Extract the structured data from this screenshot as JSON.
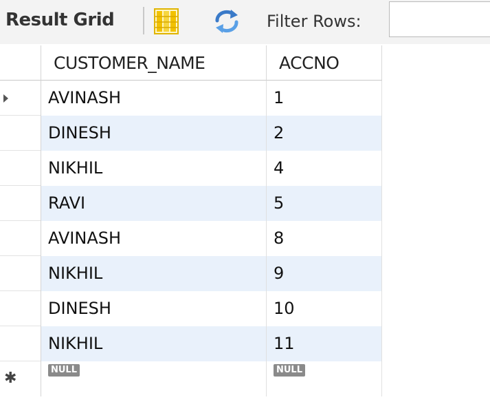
{
  "toolbar": {
    "title": "Result Grid",
    "filter_label": "Filter Rows:",
    "filter_value": ""
  },
  "grid": {
    "columns": [
      "CUSTOMER_NAME",
      "ACCNO"
    ],
    "rows": [
      {
        "name": "AVINASH",
        "accno": "1"
      },
      {
        "name": "DINESH",
        "accno": "2"
      },
      {
        "name": "NIKHIL",
        "accno": "4"
      },
      {
        "name": "RAVI",
        "accno": "5"
      },
      {
        "name": "AVINASH",
        "accno": "8"
      },
      {
        "name": "NIKHIL",
        "accno": "9"
      },
      {
        "name": "DINESH",
        "accno": "10"
      },
      {
        "name": "NIKHIL",
        "accno": "11"
      }
    ],
    "new_row": {
      "name": "NULL",
      "accno": "NULL"
    }
  },
  "icons": {
    "grid_view": "grid-view-icon",
    "refresh": "refresh-icon",
    "current_row": "current-row-arrow-icon",
    "new_row": "new-row-star-icon"
  },
  "colors": {
    "toolbar_bg": "#f3f3f3",
    "alt_row_bg": "#e9f1fb",
    "null_badge_bg": "#8a8a8a",
    "grid_icon_yellow": "#f2c200",
    "refresh_icon_blue": "#3a7ac8"
  }
}
